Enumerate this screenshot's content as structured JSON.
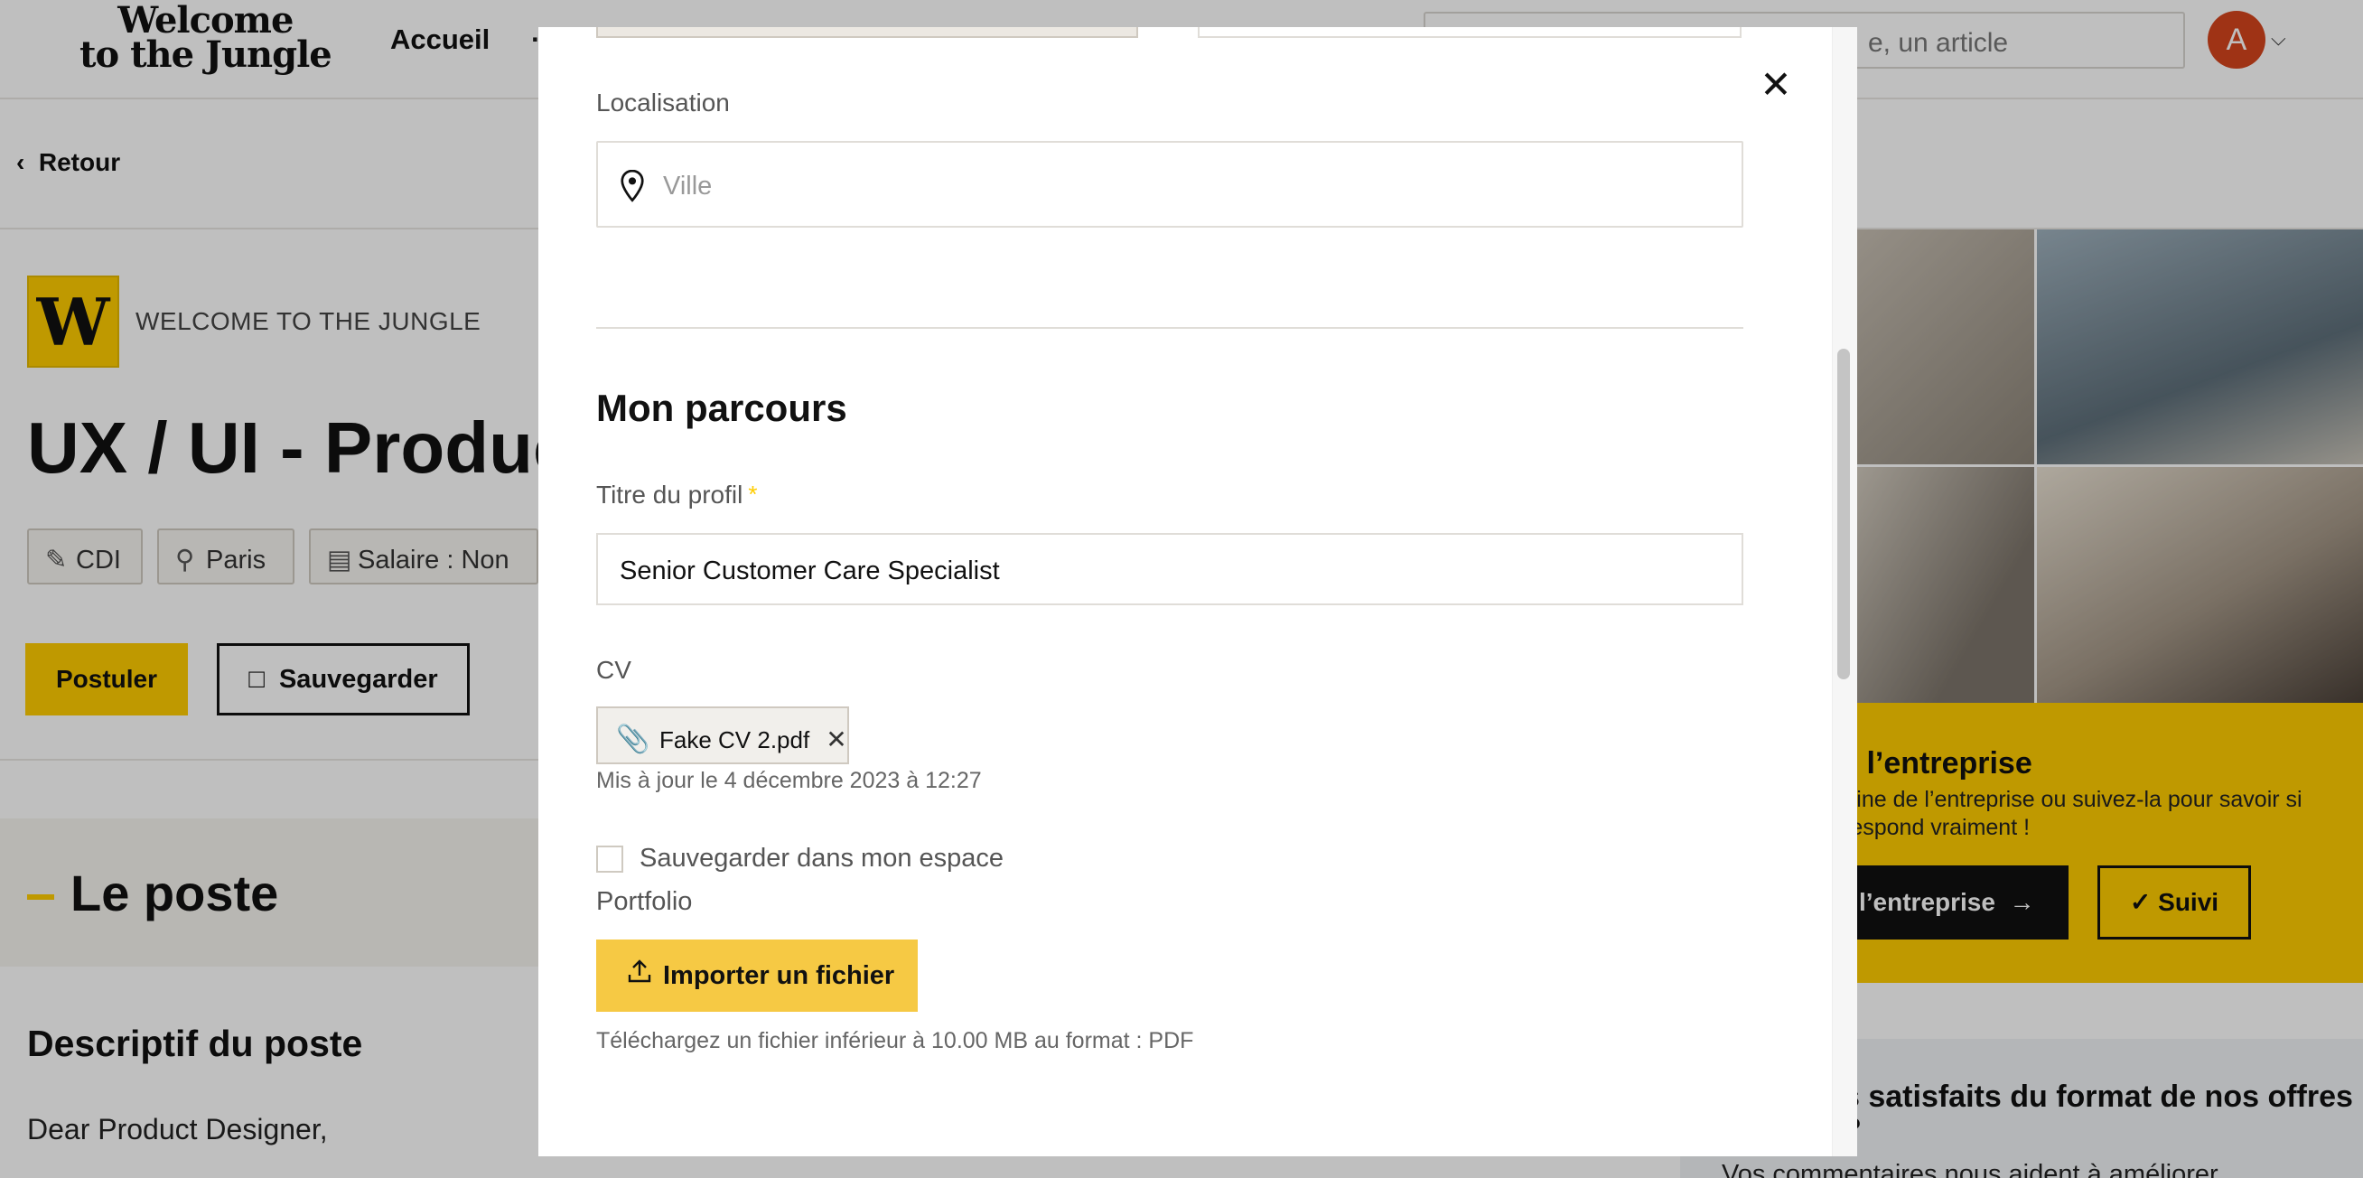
{
  "header": {
    "logo_line1": "Welcome",
    "logo_line2": "to the Jungle",
    "nav_accueil": "Accueil",
    "search_placeholder": "e, un article",
    "avatar_initial": "A"
  },
  "job": {
    "back_label": "Retour",
    "company_name": "WELCOME TO THE JUNGLE",
    "company_logo_letter": "W",
    "title": "UX / UI - Product",
    "chips": {
      "contract": "CDI",
      "location": "Paris",
      "salary": "Salaire : Non"
    },
    "apply_label": "Postuler",
    "save_label": "Sauvegarder",
    "section_title": "Le poste",
    "description_title": "Descriptif du poste",
    "description_start": "Dear Product Designer,"
  },
  "sidebar": {
    "follow_title": "z l’entreprise",
    "follow_text": "trine de l’entreprise ou suivez-la pour savoir si respond vraiment !",
    "company_button": "l’entreprise",
    "follow_button": "Suivi",
    "feedback_title": "s satisfaits du format de nos offres ?",
    "feedback_text": "Vos commentaires nous aident à améliorer"
  },
  "modal": {
    "close_icon": "close-icon",
    "location_label": "Localisation",
    "location_placeholder": "Ville",
    "section_title": "Mon parcours",
    "profile_title_label": "Titre du profil",
    "required_mark": "*",
    "profile_title_value": "Senior Customer Care Specialist",
    "cv_label": "CV",
    "cv_file_name": "Fake CV 2.pdf",
    "cv_updated": "Mis à jour le 4 décembre 2023 à 12:27",
    "save_in_space_label": "Sauvegarder dans mon espace",
    "save_in_space_checked": false,
    "portfolio_label": "Portfolio",
    "import_button": "Importer un fichier",
    "import_hint": "Téléchargez un fichier inférieur à 10.00 MB au format : PDF"
  },
  "colors": {
    "brand_yellow": "#ffcd00",
    "import_button": "#f6c944",
    "avatar": "#d4441c"
  }
}
